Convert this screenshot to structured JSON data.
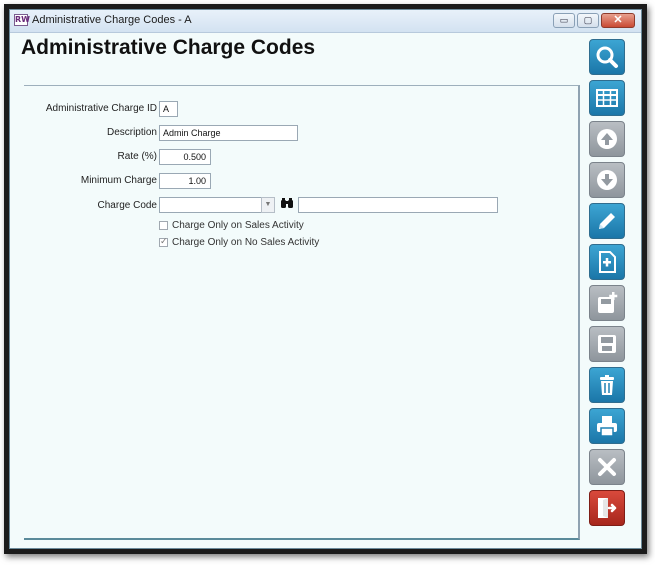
{
  "window": {
    "title": "Administrative Charge Codes - A",
    "app_icon_text": "RW",
    "minimize_glyph": "▭",
    "maximize_glyph": "▢",
    "close_glyph": "✕"
  },
  "page": {
    "title": "Administrative Charge Codes"
  },
  "form": {
    "charge_id_label": "Administrative Charge ID",
    "charge_id_value": "A",
    "description_label": "Description",
    "description_value": "Admin Charge",
    "rate_label": "Rate (%)",
    "rate_value": "0.500",
    "minimum_label": "Minimum Charge",
    "minimum_value": "1.00",
    "charge_code_label": "Charge Code",
    "charge_code_value": "",
    "charge_code_desc_value": "",
    "chk_sales_label": "Charge Only on Sales Activity",
    "chk_sales_checked": false,
    "chk_no_sales_label": "Charge Only on No Sales Activity",
    "chk_no_sales_checked": true
  },
  "toolbar": [
    {
      "icon": "search-icon",
      "color": "#1f80b3"
    },
    {
      "icon": "grid-icon",
      "color": "#1f80b3"
    },
    {
      "icon": "arrow-up-icon",
      "color": "#9aa1a8"
    },
    {
      "icon": "arrow-down-icon",
      "color": "#9aa1a8"
    },
    {
      "icon": "pencil-icon",
      "color": "#1f80b3"
    },
    {
      "icon": "new-document-icon",
      "color": "#1f80b3"
    },
    {
      "icon": "save-new-icon",
      "color": "#9aa1a8"
    },
    {
      "icon": "save-icon",
      "color": "#9aa1a8"
    },
    {
      "icon": "trash-icon",
      "color": "#1f80b3"
    },
    {
      "icon": "printer-icon",
      "color": "#1f80b3"
    },
    {
      "icon": "cancel-icon",
      "color": "#9aa1a8"
    },
    {
      "icon": "exit-icon",
      "color": "#b8322a"
    }
  ]
}
